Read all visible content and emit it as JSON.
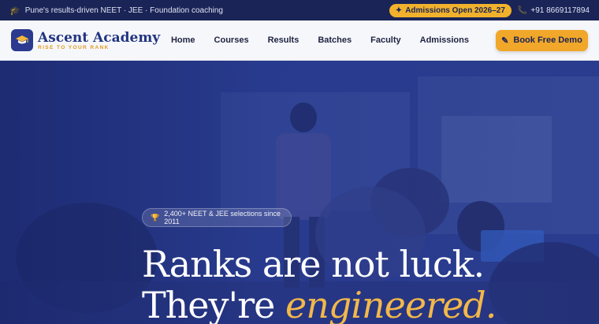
{
  "topbar": {
    "tagline": "Pune's results-driven NEET · JEE · Foundation coaching",
    "admissions_pill": "Admissions Open 2026–27",
    "phone": "+91 8669117894"
  },
  "nav": {
    "brand_name": "Ascent Academy",
    "brand_tag": "RISE TO YOUR RANK",
    "items": [
      "Home",
      "Courses",
      "Results",
      "Batches",
      "Faculty",
      "Admissions"
    ],
    "cta": "Book Free Demo"
  },
  "hero": {
    "badge": "2,400+ NEET & JEE selections since 2011",
    "line1": "Ranks are not luck.",
    "line2_prefix": "They're ",
    "line2_accent": "engineered."
  },
  "colors": {
    "topbar_bg": "#1b2456",
    "accent_gold": "#f1a72a",
    "brand_blue": "#223480"
  }
}
